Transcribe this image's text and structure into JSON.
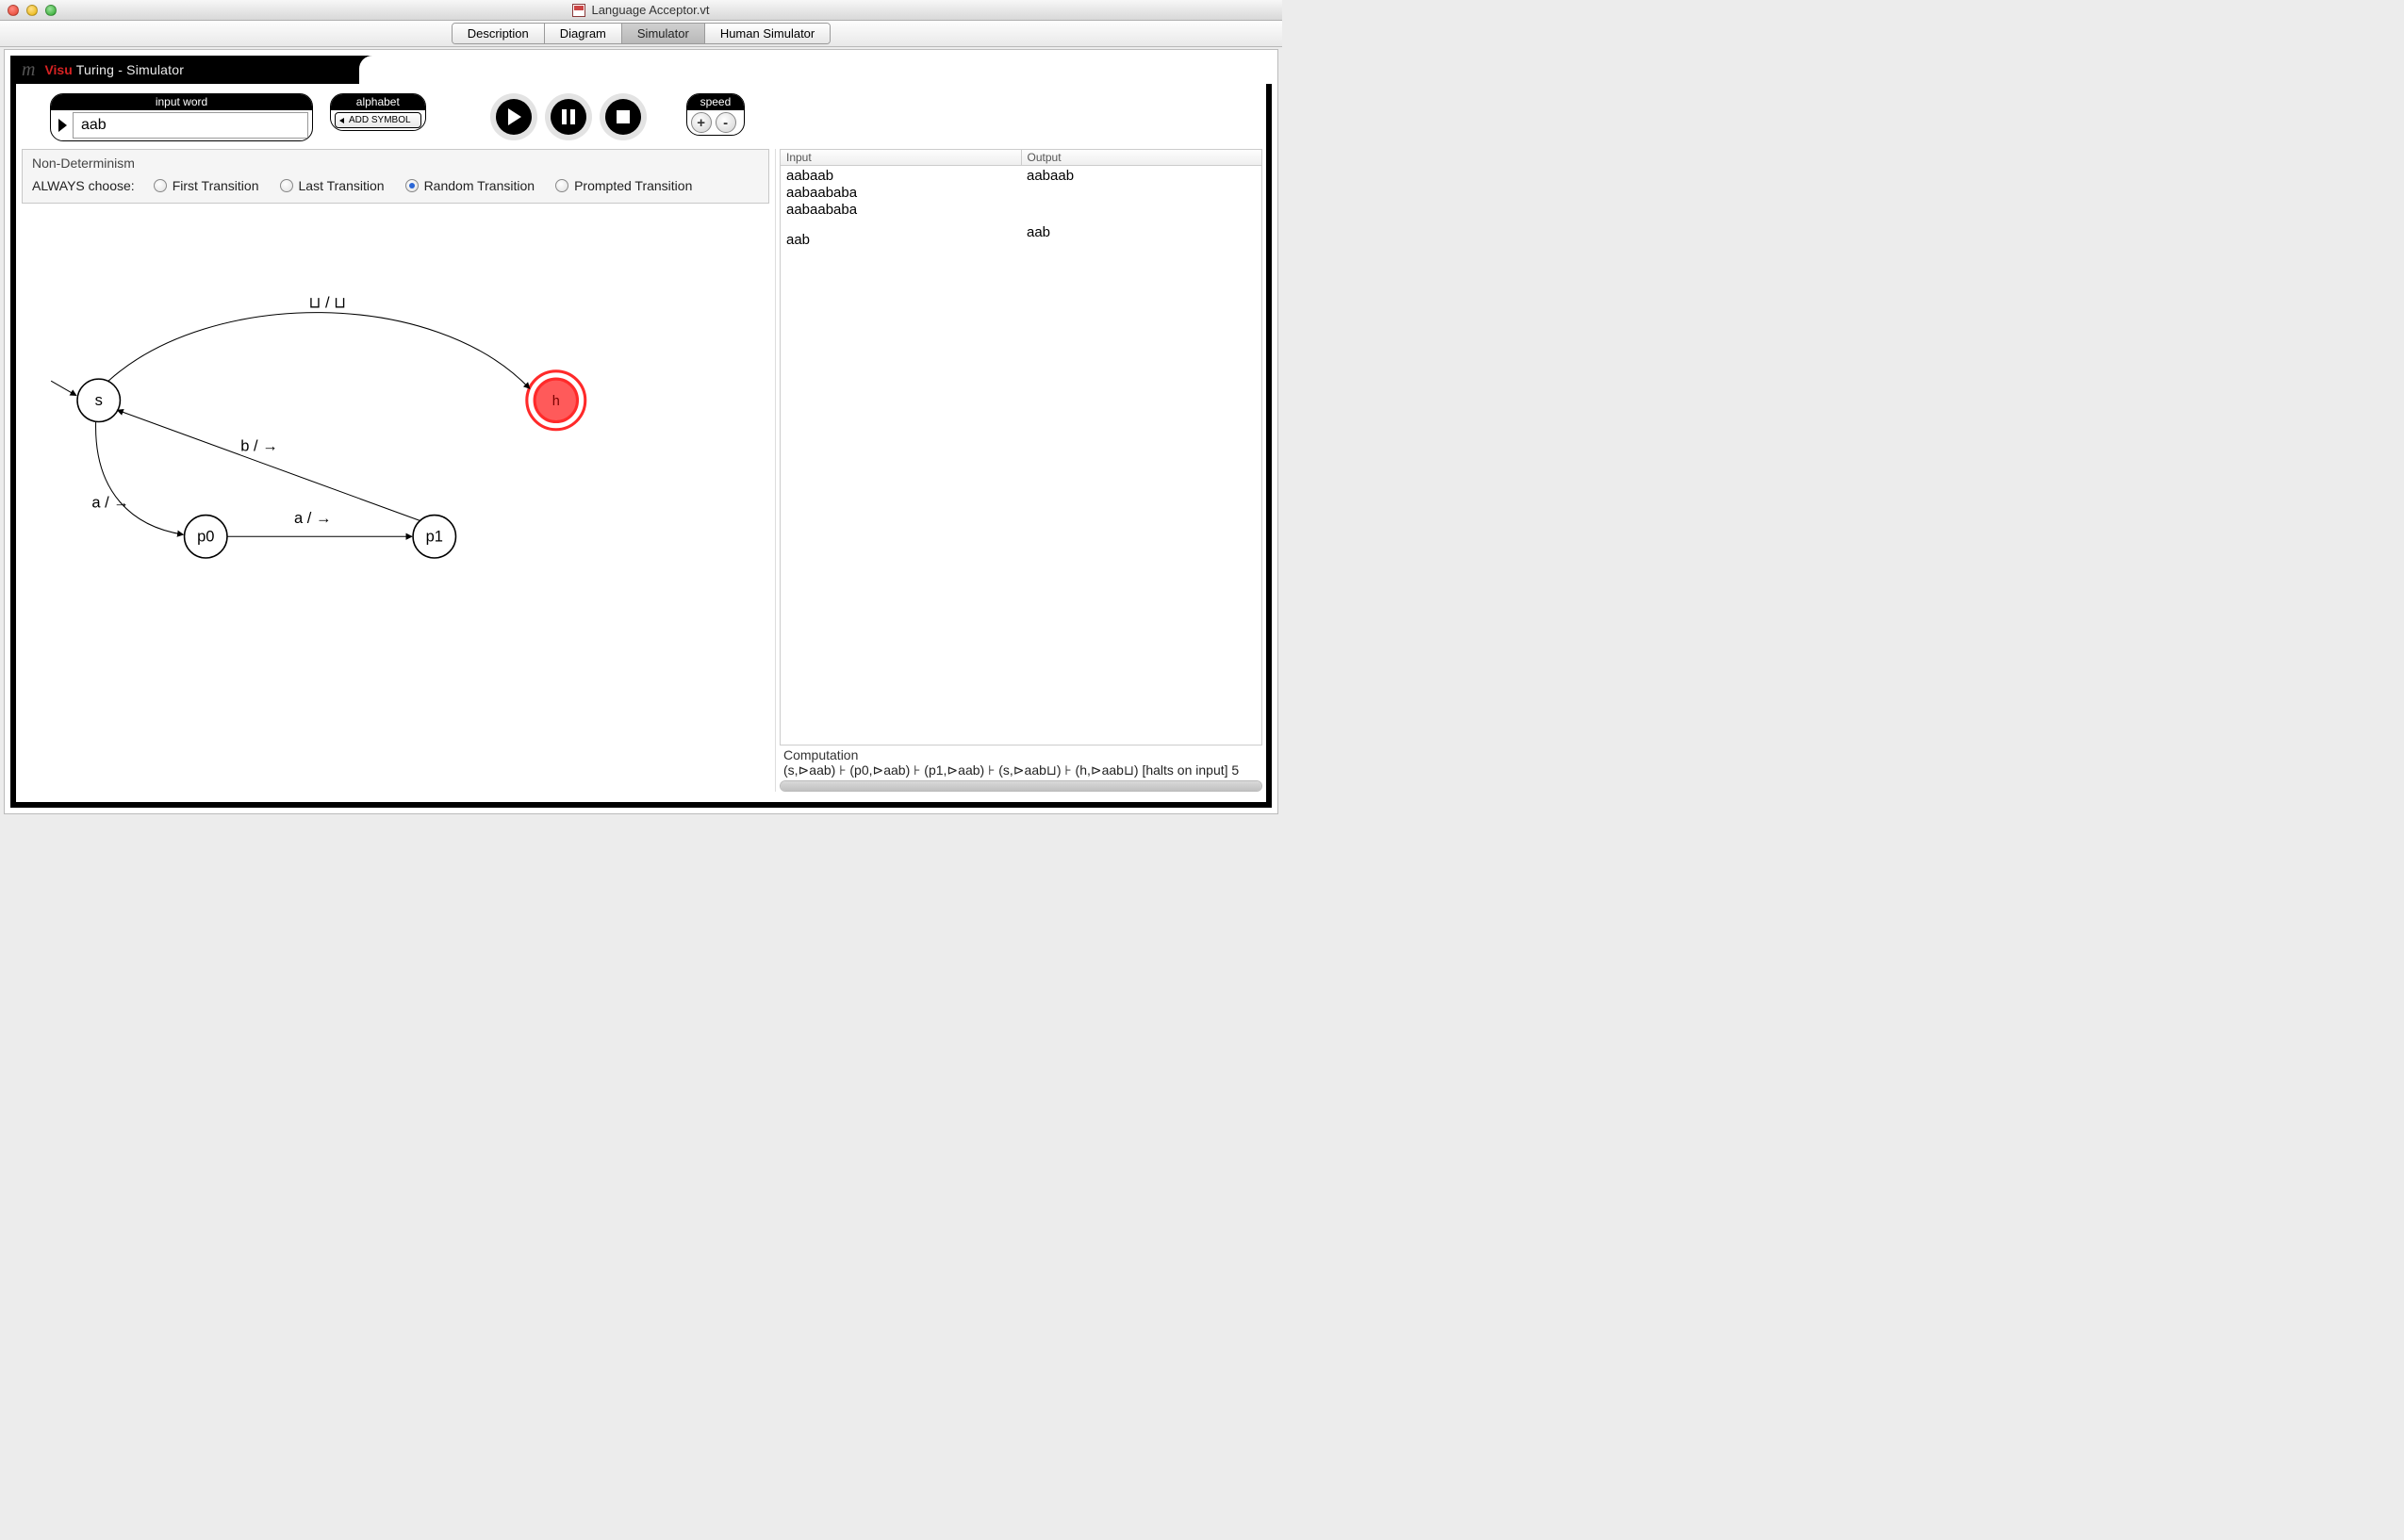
{
  "window": {
    "title": "Language Acceptor.vt"
  },
  "tabs": {
    "items": [
      "Description",
      "Diagram",
      "Simulator",
      "Human Simulator"
    ],
    "active": "Simulator"
  },
  "brand": {
    "visu": "Visu",
    "rest": "Turing - Simulator"
  },
  "toolbar": {
    "input_word_cap": "input word",
    "input_word_value": "aab",
    "alphabet_cap": "alphabet",
    "add_symbol": "ADD SYMBOL",
    "speed_cap": "speed",
    "plus": "+",
    "minus": "-"
  },
  "nondeterminism": {
    "legend": "Non-Determinism",
    "choose_label": "ALWAYS choose:",
    "options": [
      "First Transition",
      "Last Transition",
      "Random Transition",
      "Prompted Transition"
    ],
    "selected": "Random Transition"
  },
  "diagram": {
    "states": {
      "s": "s",
      "p0": "p0",
      "p1": "p1",
      "h": "h"
    },
    "labels": {
      "s_h": "⊔ / ⊔",
      "p1_s": "b / →",
      "s_p0": "a / →",
      "p0_p1": "a / →"
    }
  },
  "io": {
    "input_header": "Input",
    "output_header": "Output",
    "input_rows": [
      "aabaab",
      "aabaababa",
      "aabaababa",
      "",
      "aab"
    ],
    "output_rows": [
      "aabaab",
      "",
      "",
      "",
      "aab"
    ]
  },
  "computation": {
    "header": "Computation",
    "line": "(s,⊳aab) ⊦ (p0,⊳aab) ⊦ (p1,⊳aab) ⊦ (s,⊳aab⊔) ⊦ (h,⊳aab⊔) [halts on input] 5"
  }
}
